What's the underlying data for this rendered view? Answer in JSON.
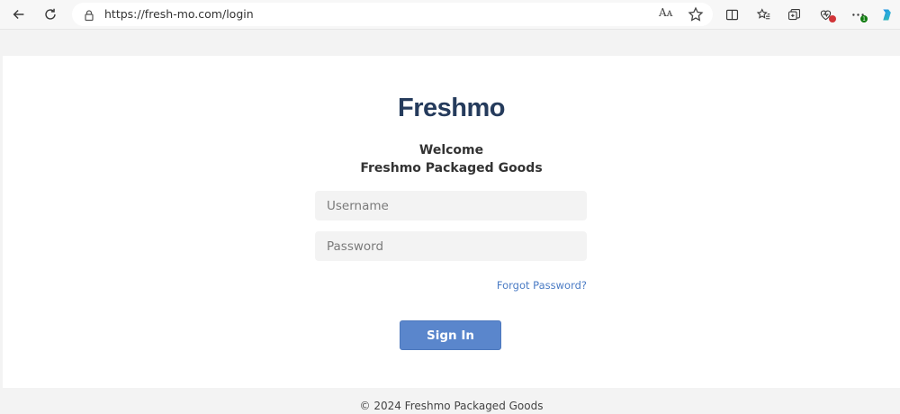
{
  "browser": {
    "url": "https://fresh-mo.com/login",
    "read_aloud_label": "Aᴀ",
    "extension_badge": "1"
  },
  "brand": {
    "logo_text": "Freshmo",
    "accent_color": "#253b5c"
  },
  "login": {
    "welcome_line1": "Welcome",
    "welcome_line2": "Freshmo Packaged Goods",
    "username_placeholder": "Username",
    "password_placeholder": "Password",
    "forgot_label": "Forgot Password?",
    "signin_label": "Sign In",
    "button_color": "#5a86cc"
  },
  "footer": {
    "copyright": "© 2024 Freshmo Packaged Goods"
  }
}
